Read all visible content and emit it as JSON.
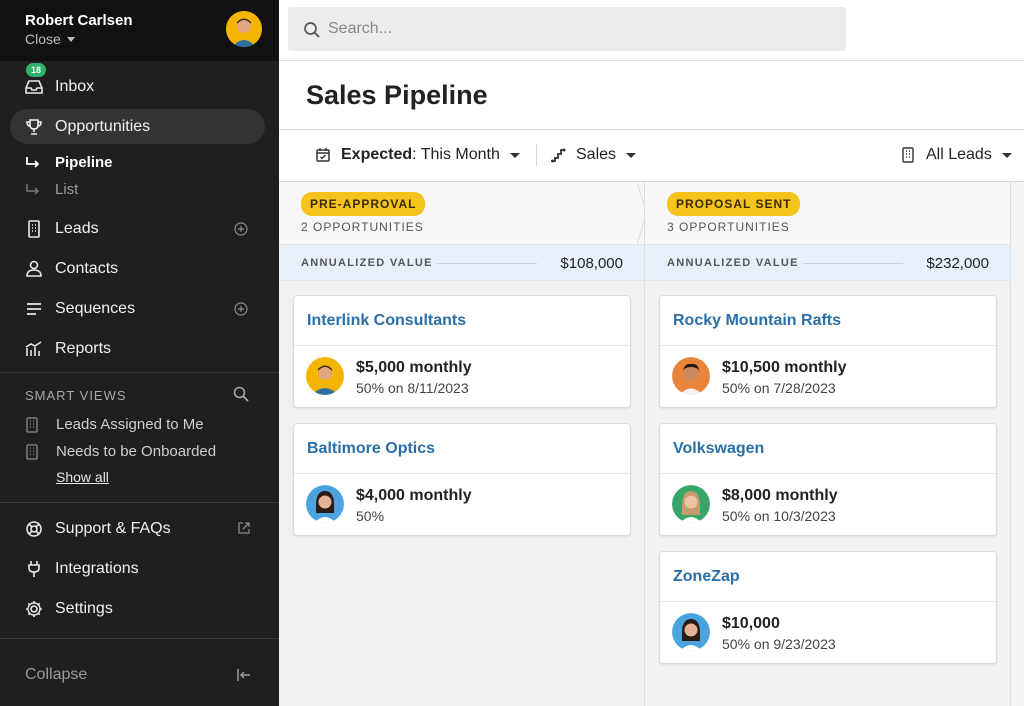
{
  "user": {
    "name": "Robert Carlsen",
    "close_label": "Close"
  },
  "search": {
    "placeholder": "Search..."
  },
  "nav": {
    "inbox": {
      "label": "Inbox",
      "badge": "18"
    },
    "opportunities": {
      "label": "Opportunities"
    },
    "pipeline": {
      "label": "Pipeline"
    },
    "list": {
      "label": "List"
    },
    "leads": {
      "label": "Leads"
    },
    "contacts": {
      "label": "Contacts"
    },
    "sequences": {
      "label": "Sequences"
    },
    "reports": {
      "label": "Reports"
    }
  },
  "smart_views": {
    "title": "SMART VIEWS",
    "items": [
      "Leads Assigned to Me",
      "Needs to be Onboarded"
    ],
    "show_all": "Show all"
  },
  "footer_nav": {
    "support": "Support & FAQs",
    "integrations": "Integrations",
    "settings": "Settings",
    "collapse": "Collapse"
  },
  "page": {
    "title": "Sales Pipeline"
  },
  "filters": {
    "expected_key": "Expected",
    "expected_value": ": This Month",
    "pipeline": "Sales",
    "leads": "All Leads"
  },
  "columns": [
    {
      "stage": "PRE-APPROVAL",
      "count": "2 OPPORTUNITIES",
      "annual_label": "ANNUALIZED VALUE",
      "annual_value": "$108,000",
      "cards": [
        {
          "name": "Interlink Consultants",
          "amount": "$5,000 monthly",
          "detail": "50% on 8/11/2023"
        },
        {
          "name": "Baltimore Optics",
          "amount": "$4,000 monthly",
          "detail": "50%"
        }
      ]
    },
    {
      "stage": "PROPOSAL SENT",
      "count": "3 OPPORTUNITIES",
      "annual_label": "ANNUALIZED VALUE",
      "annual_value": "$232,000",
      "cards": [
        {
          "name": "Rocky Mountain Rafts",
          "amount": "$10,500 monthly",
          "detail": "50% on 7/28/2023"
        },
        {
          "name": "Volkswagen",
          "amount": "$8,000 monthly",
          "detail": "50% on 10/3/2023"
        },
        {
          "name": "ZoneZap",
          "amount": "$10,000",
          "detail": "50% on 9/23/2023"
        }
      ]
    }
  ],
  "colors": {
    "sidebar_bg": "#1f1f1f",
    "stage_pill": "#f6c31c",
    "link": "#2a6fa8",
    "badge": "#2bb36a",
    "annual_bg": "#e7f0f8"
  }
}
